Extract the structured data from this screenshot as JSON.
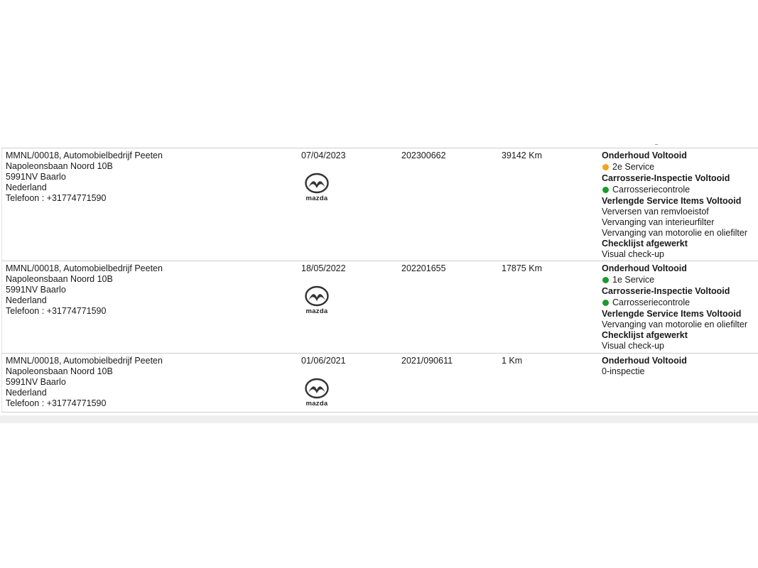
{
  "colors": {
    "dot_orange": "#f5a31a",
    "dot_green": "#1a9c2e"
  },
  "brand_logo": {
    "name": "mazda-logo",
    "text": "mazda"
  },
  "rows": [
    {
      "dealer": [
        "MMNL/00018, Automobielbedrijf Peeten",
        "Napoleonsbaan Noord 10B",
        "5991NV Baarlo",
        "Nederland",
        "Telefoon : +31774771590"
      ],
      "date": "07/04/2023",
      "order": "202300662",
      "km": "39142 Km",
      "status": [
        {
          "text": "Onderhoud Voltooid",
          "style": "bold"
        },
        {
          "text": "2e Service",
          "style": "dot",
          "color": "orange"
        },
        {
          "text": "Carrosserie-Inspectie Voltooid",
          "style": "bold"
        },
        {
          "text": "Carrosseriecontrole",
          "style": "dot",
          "color": "green"
        },
        {
          "text": "Verlengde Service Items Voltooid",
          "style": "bold"
        },
        {
          "text": "Verversen van remvloeistof",
          "style": "plain"
        },
        {
          "text": "Vervanging van interieurfilter",
          "style": "plain"
        },
        {
          "text": "Vervanging van motorolie en oliefilter",
          "style": "plain"
        },
        {
          "text": "Checklijst afgewerkt",
          "style": "bold"
        },
        {
          "text": "Visual check-up",
          "style": "plain"
        }
      ]
    },
    {
      "dealer": [
        "MMNL/00018, Automobielbedrijf Peeten",
        "Napoleonsbaan Noord 10B",
        "5991NV Baarlo",
        "Nederland",
        "Telefoon : +31774771590"
      ],
      "date": "18/05/2022",
      "order": "202201655",
      "km": "17875 Km",
      "status": [
        {
          "text": "Onderhoud Voltooid",
          "style": "bold"
        },
        {
          "text": "1e Service",
          "style": "dot",
          "color": "green"
        },
        {
          "text": "Carrosserie-Inspectie Voltooid",
          "style": "bold"
        },
        {
          "text": "Carrosseriecontrole",
          "style": "dot",
          "color": "green"
        },
        {
          "text": "Verlengde Service Items Voltooid",
          "style": "bold"
        },
        {
          "text": "Vervanging van motorolie en oliefilter",
          "style": "plain"
        },
        {
          "text": "Checklijst afgewerkt",
          "style": "bold"
        },
        {
          "text": "Visual check-up",
          "style": "plain"
        }
      ]
    },
    {
      "dealer": [
        "MMNL/00018, Automobielbedrijf Peeten",
        "Napoleonsbaan Noord 10B",
        "5991NV Baarlo",
        "Nederland",
        "Telefoon : +31774771590"
      ],
      "date": "01/06/2021",
      "order": "2021/090611",
      "km": "1 Km",
      "status": [
        {
          "text": "Onderhoud Voltooid",
          "style": "bold"
        },
        {
          "text": "0-inspectie",
          "style": "plain"
        }
      ]
    }
  ]
}
